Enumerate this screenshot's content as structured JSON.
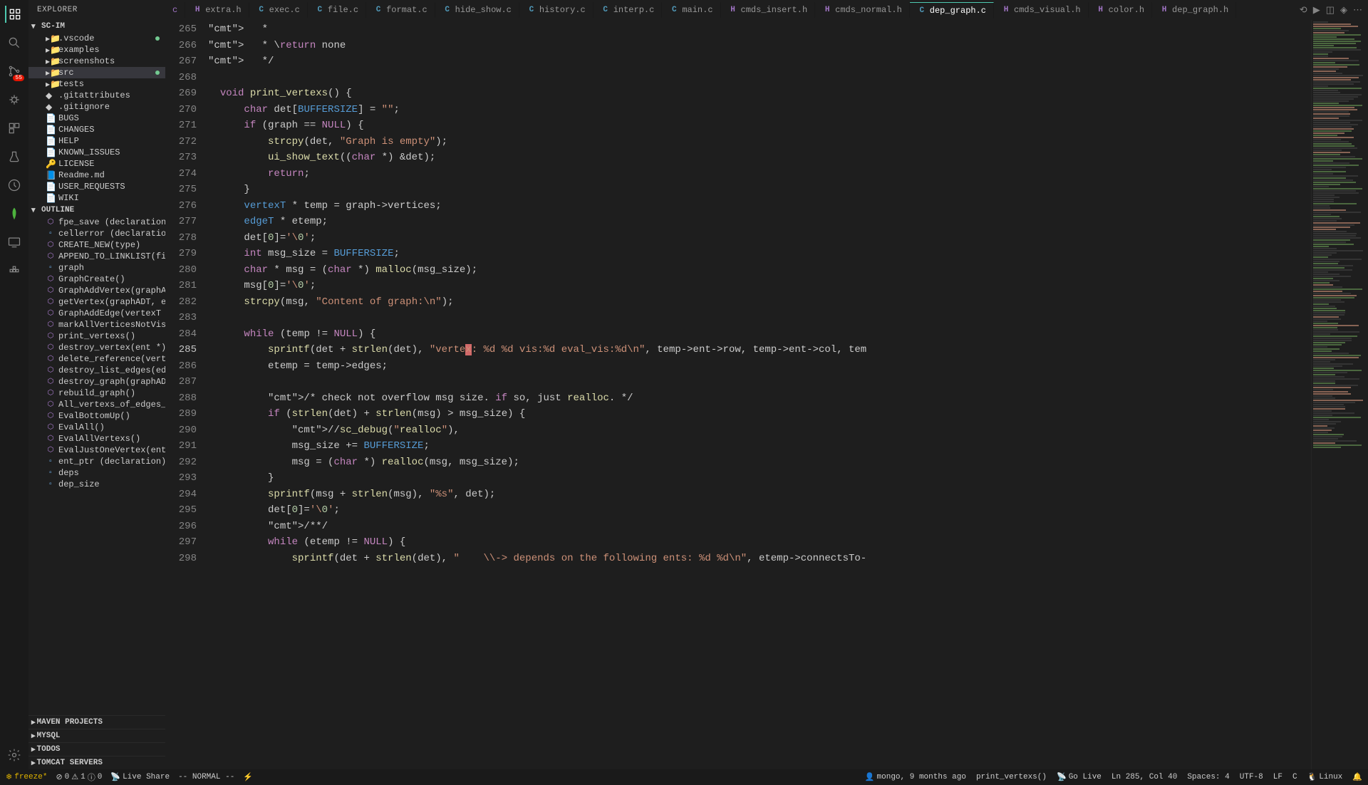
{
  "explorer": {
    "title": "EXPLORER"
  },
  "project": {
    "name": "SC-IM"
  },
  "fileTree": [
    {
      "name": ".vscode",
      "icon": "folder",
      "dot": true
    },
    {
      "name": "examples",
      "icon": "folder"
    },
    {
      "name": "screenshots",
      "icon": "folder"
    },
    {
      "name": "src",
      "icon": "folder",
      "dot": true,
      "selected": true
    },
    {
      "name": "tests",
      "icon": "folder"
    },
    {
      "name": ".gitattributes",
      "icon": "git"
    },
    {
      "name": ".gitignore",
      "icon": "git"
    },
    {
      "name": "BUGS",
      "icon": "file"
    },
    {
      "name": "CHANGES",
      "icon": "file"
    },
    {
      "name": "HELP",
      "icon": "file"
    },
    {
      "name": "KNOWN_ISSUES",
      "icon": "file"
    },
    {
      "name": "LICENSE",
      "icon": "license"
    },
    {
      "name": "Readme.md",
      "icon": "md"
    },
    {
      "name": "USER_REQUESTS",
      "icon": "file"
    },
    {
      "name": "WIKI",
      "icon": "file"
    }
  ],
  "outline": {
    "title": "OUTLINE"
  },
  "outlineItems": [
    {
      "label": "fpe_save (declaration)",
      "sym": "fn"
    },
    {
      "label": "cellerror (declaration)",
      "sym": "var"
    },
    {
      "label": "CREATE_NEW(type)",
      "sym": "fn"
    },
    {
      "label": "APPEND_TO_LINKLIST(firstNod...",
      "sym": "fn"
    },
    {
      "label": "graph",
      "sym": "var"
    },
    {
      "label": "GraphCreate()",
      "sym": "fn"
    },
    {
      "label": "GraphAddVertex(graphADT, ent *)",
      "sym": "fn"
    },
    {
      "label": "getVertex(graphADT, ent *, int)",
      "sym": "fn"
    },
    {
      "label": "GraphAddEdge(vertexT *, ent *,...",
      "sym": "fn"
    },
    {
      "label": "markAllVerticesNotVisited(int)",
      "sym": "fn"
    },
    {
      "label": "print_vertexs()",
      "sym": "fn"
    },
    {
      "label": "destroy_vertex(ent *)",
      "sym": "fn"
    },
    {
      "label": "delete_reference(vertexT *, vert...",
      "sym": "fn"
    },
    {
      "label": "destroy_list_edges(edgeT *)",
      "sym": "fn"
    },
    {
      "label": "destroy_graph(graphADT)",
      "sym": "fn"
    },
    {
      "label": "rebuild_graph()",
      "sym": "fn"
    },
    {
      "label": "All_vertexs_of_edges_visited(ed...",
      "sym": "fn"
    },
    {
      "label": "EvalBottomUp()",
      "sym": "fn"
    },
    {
      "label": "EvalAll()",
      "sym": "fn"
    },
    {
      "label": "EvalAllVertexs()",
      "sym": "fn"
    },
    {
      "label": "EvalJustOneVertex(ent *, int, int...",
      "sym": "fn"
    },
    {
      "label": "ent_ptr (declaration)",
      "sym": "var"
    },
    {
      "label": "deps",
      "sym": "var"
    },
    {
      "label": "dep_size",
      "sym": "var"
    }
  ],
  "bottomSections": [
    {
      "label": "MAVEN PROJECTS"
    },
    {
      "label": "MYSQL"
    },
    {
      "label": "TODOS"
    },
    {
      "label": "TOMCAT SERVERS"
    }
  ],
  "tabs": [
    {
      "label": "extra.h",
      "type": "h"
    },
    {
      "label": "exec.c",
      "type": "c"
    },
    {
      "label": "file.c",
      "type": "c"
    },
    {
      "label": "format.c",
      "type": "c"
    },
    {
      "label": "hide_show.c",
      "type": "c"
    },
    {
      "label": "history.c",
      "type": "c"
    },
    {
      "label": "interp.c",
      "type": "c"
    },
    {
      "label": "main.c",
      "type": "c"
    },
    {
      "label": "cmds_insert.h",
      "type": "h"
    },
    {
      "label": "cmds_normal.h",
      "type": "h"
    },
    {
      "label": "dep_graph.c",
      "type": "c",
      "active": true
    },
    {
      "label": "cmds_visual.h",
      "type": "h"
    },
    {
      "label": "color.h",
      "type": "h"
    },
    {
      "label": "dep_graph.h",
      "type": "h"
    }
  ],
  "lineNumbers": [
    265,
    266,
    267,
    268,
    269,
    270,
    271,
    272,
    273,
    274,
    275,
    276,
    277,
    278,
    279,
    280,
    281,
    282,
    283,
    284,
    285,
    286,
    287,
    288,
    289,
    290,
    291,
    292,
    293,
    294,
    295,
    296,
    297,
    298
  ],
  "currentLine": 285,
  "codeLines": [
    "   *",
    "   * \\return none",
    "   */",
    "",
    "  void print_vertexs() {",
    "      char det[BUFFERSIZE] = \"\";",
    "      if (graph == NULL) {",
    "          strcpy(det, \"Graph is empty\");",
    "          ui_show_text((char *) &det);",
    "          return;",
    "      }",
    "      vertexT * temp = graph->vertices;",
    "      edgeT * etemp;",
    "      det[0]='\\0';",
    "      int msg_size = BUFFERSIZE;",
    "      char * msg = (char *) malloc(msg_size);",
    "      msg[0]='\\0';",
    "      strcpy(msg, \"Content of graph:\\n\");",
    "",
    "      while (temp != NULL) {",
    "          sprintf(det + strlen(det), \"vertex: %d %d vis:%d eval_vis:%d\\n\", temp->ent->row, temp->ent->col, tem",
    "          etemp = temp->edges;",
    "",
    "          /* check not overflow msg size. if so, just realloc. */",
    "          if (strlen(det) + strlen(msg) > msg_size) {",
    "              //sc_debug(\"realloc\"),",
    "              msg_size += BUFFERSIZE;",
    "              msg = (char *) realloc(msg, msg_size);",
    "          }",
    "          sprintf(msg + strlen(msg), \"%s\", det);",
    "          det[0]='\\0';",
    "          /**/",
    "          while (etemp != NULL) {",
    "              sprintf(det + strlen(det), \"    \\\\-> depends on the following ents: %d %d\\n\", etemp->connectsTo-"
  ],
  "status": {
    "freeze": "freeze*",
    "errors": "0",
    "warnings": "1",
    "info": "0",
    "liveShare": "Live Share",
    "vimMode": "-- NORMAL --",
    "blame": "mongo, 9 months ago",
    "function": "print_vertexs()",
    "goLive": "Go Live",
    "position": "Ln 285, Col 40",
    "spaces": "Spaces: 4",
    "encoding": "UTF-8",
    "eol": "LF",
    "language": "C",
    "os": "Linux"
  }
}
